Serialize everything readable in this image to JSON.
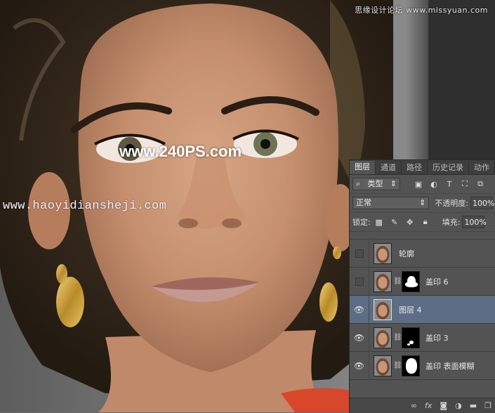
{
  "watermarks": {
    "top_right": "思缘设计论坛 www.missyuan.com",
    "center": "www.240PS.com",
    "url": "www.haoyidiansheji.com"
  },
  "panel": {
    "tabs": [
      "图层",
      "通道",
      "路径",
      "历史记录",
      "动作"
    ],
    "active_tab": 0,
    "filter_kind": "类型",
    "blend_mode": "正常",
    "opacity_label": "不透明度:",
    "opacity_value": "100%",
    "lock_label": "锁定:",
    "fill_label": "填充:",
    "fill_value": "100%",
    "layers": [
      {
        "name": "轮廓",
        "visible": false,
        "has_mask": false,
        "selected": false
      },
      {
        "name": "盖印 6",
        "visible": false,
        "has_mask": true,
        "selected": false
      },
      {
        "name": "图层 4",
        "visible": true,
        "has_mask": false,
        "selected": true
      },
      {
        "name": "盖印 3",
        "visible": true,
        "has_mask": true,
        "selected": false
      },
      {
        "name": "盖印 表面模糊",
        "visible": true,
        "has_mask": true,
        "selected": false
      }
    ],
    "footer_icons": [
      "link-icon",
      "fx-icon",
      "add-mask-icon",
      "adjustment-icon",
      "group-folder-icon",
      "new-layer-icon",
      "delete-icon"
    ]
  },
  "colors": {
    "panel_bg": "#535353",
    "selected_layer": "#5c6d85",
    "skin": "#c99574"
  }
}
